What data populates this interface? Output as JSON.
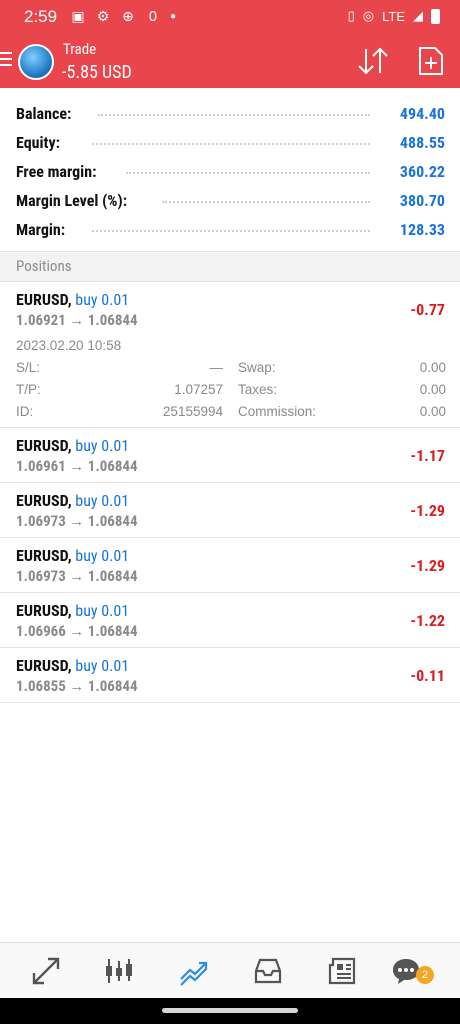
{
  "status_bar": {
    "time": "2:59",
    "network": "LTE"
  },
  "header": {
    "title": "Trade",
    "pl": "-5.85 USD"
  },
  "summary": [
    {
      "label": "Balance:",
      "value": "494.40"
    },
    {
      "label": "Equity:",
      "value": "488.55"
    },
    {
      "label": "Free margin:",
      "value": "360.22"
    },
    {
      "label": "Margin Level (%):",
      "value": "380.70"
    },
    {
      "label": "Margin:",
      "value": "128.33"
    }
  ],
  "positions_title": "Positions",
  "positions": [
    {
      "symbol": "EURUSD,",
      "side": "buy 0.01",
      "prices": "1.06921 → 1.06844",
      "profit": "-0.77",
      "date": "2023.02.20 10:58",
      "sl_label": "S/L:",
      "sl": "—",
      "tp_label": "T/P:",
      "tp": "1.07257",
      "id_label": "ID:",
      "id": "25155994",
      "swap_label": "Swap:",
      "swap": "0.00",
      "taxes_label": "Taxes:",
      "taxes": "0.00",
      "commission_label": "Commission:",
      "commission": "0.00"
    },
    {
      "symbol": "EURUSD,",
      "side": "buy 0.01",
      "prices": "1.06961 → 1.06844",
      "profit": "-1.17"
    },
    {
      "symbol": "EURUSD,",
      "side": "buy 0.01",
      "prices": "1.06973 → 1.06844",
      "profit": "-1.29"
    },
    {
      "symbol": "EURUSD,",
      "side": "buy 0.01",
      "prices": "1.06973 → 1.06844",
      "profit": "-1.29"
    },
    {
      "symbol": "EURUSD,",
      "side": "buy 0.01",
      "prices": "1.06966 → 1.06844",
      "profit": "-1.22"
    },
    {
      "symbol": "EURUSD,",
      "side": "buy 0.01",
      "prices": "1.06855 → 1.06844",
      "profit": "-0.11"
    }
  ],
  "bottom_nav": {
    "chat_badge": "2"
  },
  "colors": {
    "header": "#e8454d",
    "value_blue": "#1a73d9",
    "loss_red": "#d81e1e",
    "badge": "#f5a623"
  }
}
